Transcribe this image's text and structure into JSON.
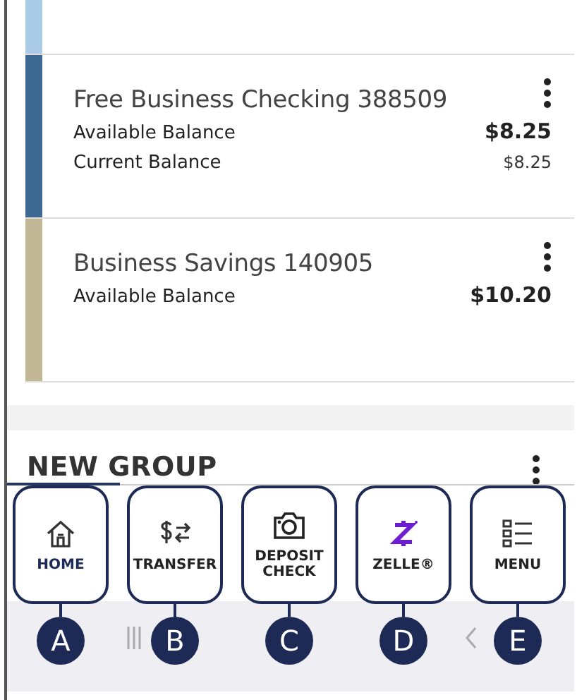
{
  "top_stub": {
    "color": "#a9cbe6"
  },
  "accounts": [
    {
      "name": "Free Business Checking 388509",
      "color": "#3d6891",
      "balances": [
        {
          "label": "Available Balance",
          "amount": "$8.25",
          "kind": "primary"
        },
        {
          "label": "Current Balance",
          "amount": "$8.25",
          "kind": "secondary"
        }
      ]
    },
    {
      "name": "Business Savings 140905",
      "color": "#c3b896",
      "balances": [
        {
          "label": "Available Balance",
          "amount": "$10.20",
          "kind": "primary"
        }
      ]
    }
  ],
  "group": {
    "title": "NEW GROUP"
  },
  "nav": [
    {
      "kind": "home",
      "label": "HOME",
      "selected": true,
      "callout": "A"
    },
    {
      "kind": "transfer",
      "label": "TRANSFER",
      "selected": false,
      "callout": "B"
    },
    {
      "kind": "deposit",
      "label": "DEPOSIT CHECK",
      "selected": false,
      "callout": "C"
    },
    {
      "kind": "zelle",
      "label": "ZELLE®",
      "selected": false,
      "callout": "D"
    },
    {
      "kind": "menu",
      "label": "MENU",
      "selected": false,
      "callout": "E"
    }
  ]
}
